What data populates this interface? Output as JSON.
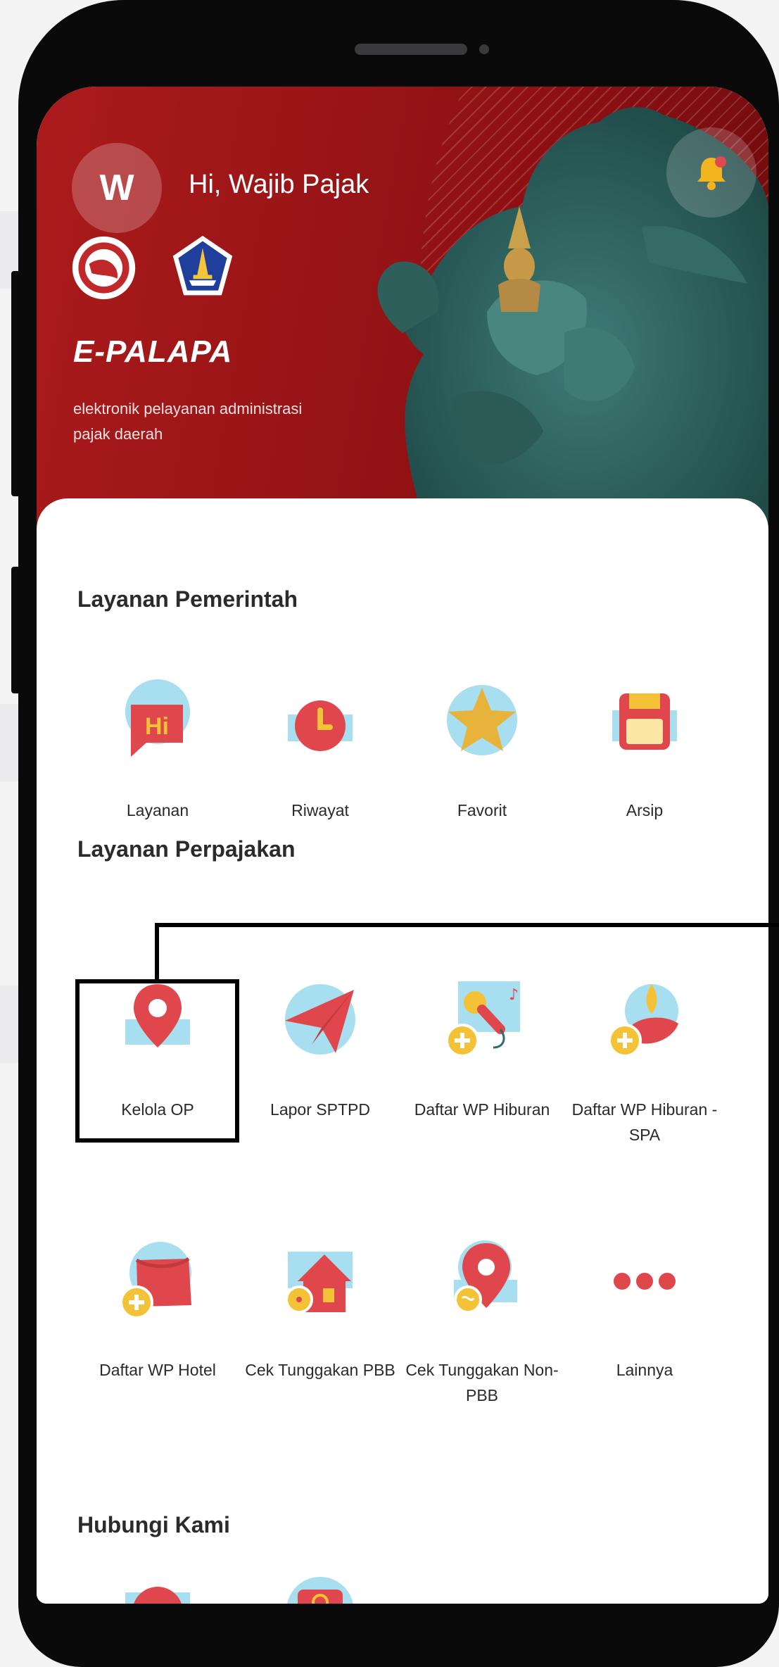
{
  "header": {
    "avatar_initial": "W",
    "greeting": "Hi, Wajib Pajak",
    "app_title": "E-PALAPA",
    "tagline": "elektronik pelayanan administrasi pajak daerah"
  },
  "sections": {
    "government": {
      "title": "Layanan Pemerintah",
      "items": [
        {
          "label": "Layanan",
          "icon": "chat-hi-icon"
        },
        {
          "label": "Riwayat",
          "icon": "clock-icon"
        },
        {
          "label": "Favorit",
          "icon": "star-icon"
        },
        {
          "label": "Arsip",
          "icon": "floppy-disk-icon"
        }
      ]
    },
    "tax": {
      "title": "Layanan Perpajakan",
      "items": [
        {
          "label": "Kelola OP",
          "icon": "map-pin-icon"
        },
        {
          "label": "Lapor SPTPD",
          "icon": "paper-plane-icon"
        },
        {
          "label": "Daftar WP Hiburan",
          "icon": "microphone-add-icon"
        },
        {
          "label": "Daftar WP Hiburan - SPA",
          "icon": "spa-add-icon"
        },
        {
          "label": "Daftar WP Hotel",
          "icon": "bed-add-icon"
        },
        {
          "label": "Cek Tunggakan PBB",
          "icon": "house-coin-icon"
        },
        {
          "label": "Cek Tunggakan Non-PBB",
          "icon": "pin-coin-icon"
        },
        {
          "label": "Lainnya",
          "icon": "more-dots-icon"
        }
      ]
    },
    "contact": {
      "title": "Hubungi Kami",
      "items": [
        {
          "label": "",
          "icon": "phone-icon"
        },
        {
          "label": "",
          "icon": "email-icon"
        }
      ]
    }
  },
  "colors": {
    "brand_red": "#ab1b1c",
    "icon_red": "#e0474c",
    "icon_blue": "#a7def0",
    "icon_yellow": "#f4c236"
  }
}
